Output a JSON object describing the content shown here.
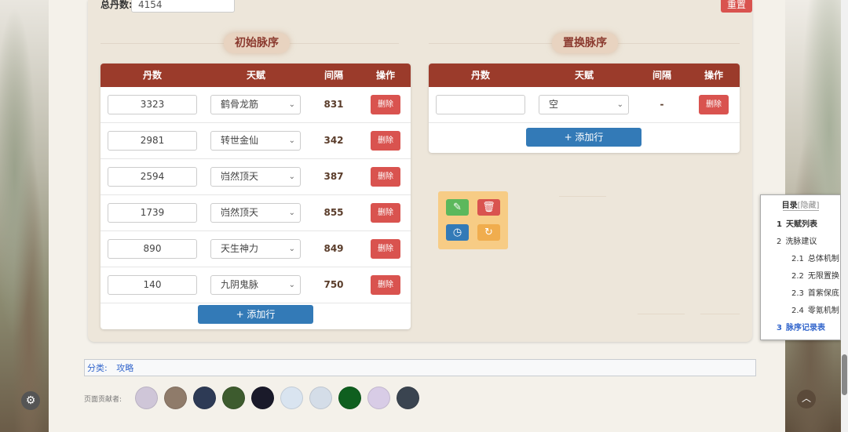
{
  "header": {
    "total_label": "总丹数:",
    "total_value": "4154",
    "reset_label": "重置"
  },
  "initial": {
    "title": "初始脉序",
    "columns": [
      "丹数",
      "天赋",
      "间隔",
      "操作"
    ],
    "rows": [
      {
        "dan": "3323",
        "talent": "鹤骨龙筋",
        "interval": "831",
        "action": "删除"
      },
      {
        "dan": "2981",
        "talent": "转世金仙",
        "interval": "342",
        "action": "删除"
      },
      {
        "dan": "2594",
        "talent": "岿然顶天",
        "interval": "387",
        "action": "删除"
      },
      {
        "dan": "1739",
        "talent": "岿然顶天",
        "interval": "855",
        "action": "删除"
      },
      {
        "dan": "890",
        "talent": "天生神力",
        "interval": "849",
        "action": "删除"
      },
      {
        "dan": "140",
        "talent": "九阴鬼脉",
        "interval": "750",
        "action": "删除"
      }
    ],
    "add_label": "+ 添加行"
  },
  "replace": {
    "title": "置换脉序",
    "columns": [
      "丹数",
      "天赋",
      "间隔",
      "操作"
    ],
    "rows": [
      {
        "dan": "",
        "talent": "空",
        "interval": "-",
        "action": "删除"
      }
    ],
    "add_label": "+ 添加行"
  },
  "tools": {
    "icons": [
      "pencil-icon",
      "trash-icon",
      "clock-icon",
      "refresh-icon"
    ],
    "colors": {
      "edit": "#5cb85c",
      "delete": "#d9534f",
      "history": "#337ab7",
      "refresh": "#f0ad4e"
    }
  },
  "toc": {
    "title": "目录",
    "hide": "[隐藏]",
    "items": [
      {
        "num": "1",
        "label": "天赋列表"
      },
      {
        "num": "2",
        "label": "洗脉建议"
      },
      {
        "num": "2.1",
        "label": "总体机制"
      },
      {
        "num": "2.2",
        "label": "无限置换"
      },
      {
        "num": "2.3",
        "label": "首紫保底"
      },
      {
        "num": "2.4",
        "label": "零氪机制"
      },
      {
        "num": "3",
        "label": "脉序记录表"
      }
    ]
  },
  "category": {
    "label": "分类:",
    "link": "攻略"
  },
  "contributors": {
    "label": "页面贡献者:",
    "avatar_colors": [
      "#cfc6d8",
      "#8f7b6a",
      "#2d3a55",
      "#3d5b2e",
      "#1a1a2a",
      "#d9e4f0",
      "#d4dde8",
      "#0f5f1f",
      "#d8cce6",
      "#3a4450"
    ]
  },
  "colors": {
    "header_red": "#9b3b2b",
    "delete_red": "#d9534f",
    "add_blue": "#337ab7",
    "toolbox_orange": "#f7cc85"
  }
}
